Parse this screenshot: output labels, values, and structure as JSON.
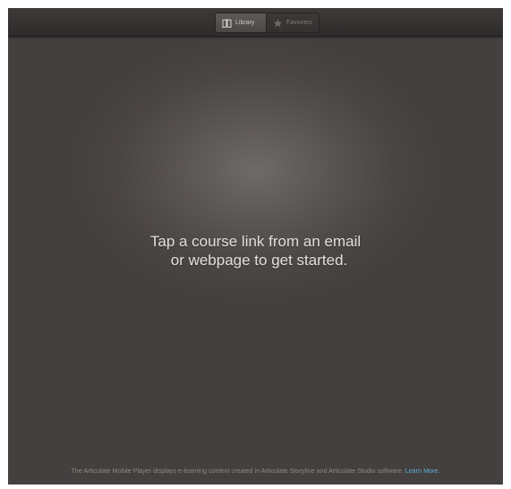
{
  "tabs": [
    {
      "label": "Library",
      "icon": "book-icon",
      "selected": true
    },
    {
      "label": "Favorites",
      "icon": "star-icon",
      "selected": false
    }
  ],
  "main": {
    "message_line1": "Tap a course link from an email",
    "message_line2": "or webpage to get started."
  },
  "footer": {
    "text": "The Articulate Mobile Player displays e-learning content created in Articulate Storyline and Articulate Studio software.",
    "link": "Learn More."
  },
  "colors": {
    "background": "#4a4543",
    "topbar": "#343130",
    "link": "#5fb2d6"
  }
}
